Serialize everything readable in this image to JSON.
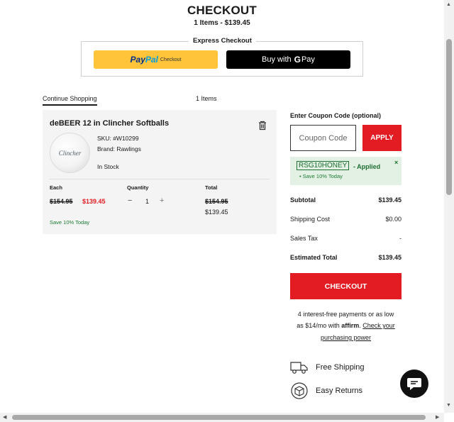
{
  "header": {
    "title": "CHECKOUT",
    "subtitle": "1 Items - $139.45"
  },
  "express_checkout": {
    "label": "Express Checkout",
    "paypal": {
      "word1": "Pay",
      "word2": "Pal",
      "suffix": "Checkout"
    },
    "gpay": {
      "prefix": "Buy with",
      "g": "G",
      "pay": "Pay"
    }
  },
  "cart_header": {
    "continue_shopping": "Continue Shopping",
    "items_count": "1 Items"
  },
  "cart_item": {
    "name": "deBEER 12 in Clincher Softballs",
    "image_text": "Clincher",
    "sku": "SKU: #W10299",
    "brand": "Brand: Rawlings",
    "stock": "In Stock",
    "col_each": "Each",
    "col_quantity": "Quantity",
    "col_total": "Total",
    "price_original": "$154.95",
    "price_sale": "$139.45",
    "qty_minus": "−",
    "quantity": "1",
    "qty_plus": "+",
    "total_original": "$154.95",
    "total_sale": "$139.45",
    "save_note": "Save 10% Today"
  },
  "coupon": {
    "label": "Enter Coupon Code (optional)",
    "placeholder": "Coupon Code",
    "apply_label": "APPLY",
    "applied_code": "RSG10HONEY",
    "applied_text": "- Applied",
    "close": "×",
    "save_note": "Save 10% Today"
  },
  "summary": {
    "subtotal_label": "Subtotal",
    "subtotal_value": "$139.45",
    "shipping_label": "Shipping Cost",
    "shipping_value": "$0.00",
    "tax_label": "Sales Tax",
    "tax_value": "-",
    "total_label": "Estimated Total",
    "total_value": "$139.45"
  },
  "checkout_button": "CHECKOUT",
  "affirm": {
    "line1": "4 interest-free payments or as low",
    "line2_prefix": "as $14/mo with",
    "logo": "affirm",
    "link1": "Check your",
    "link2": "purchasing power"
  },
  "perks": {
    "free_shipping": "Free Shipping",
    "easy_returns": "Easy Returns"
  },
  "colors": {
    "accent_red": "#e31b23",
    "success_green": "#1c6e30",
    "paypal_yellow": "#ffc439"
  }
}
